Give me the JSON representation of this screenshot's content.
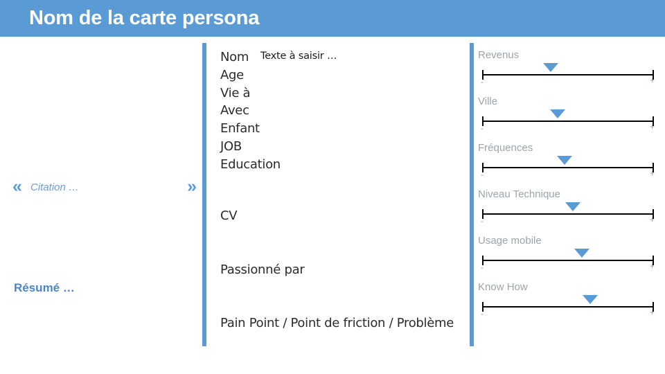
{
  "header": {
    "title": "Nom de la carte persona",
    "background_color": "#5b9bd5",
    "text_color": "#ffffff"
  },
  "left_column": {
    "quote": {
      "open_mark": "«",
      "text": "Citation …",
      "close_mark": "»",
      "color": "#6a9ed2"
    },
    "resume_label": "Résumé …",
    "resume_color": "#4a86c8"
  },
  "middle_column": {
    "placeholder": "Texte à saisir …",
    "fields": [
      {
        "label": "Nom"
      },
      {
        "label": "Age"
      },
      {
        "label": "Vie à"
      },
      {
        "label": "Avec"
      },
      {
        "label": "Enfant"
      },
      {
        "label": "JOB"
      },
      {
        "label": "Education"
      }
    ],
    "headings": {
      "cv": "CV",
      "passion": "Passionné par",
      "pain_point": "Pain Point / Point de friction / Problème"
    }
  },
  "right_column": {
    "minus_symbol": "-",
    "plus_symbol": "+",
    "marker_color": "#5b9bd5",
    "label_color": "#9aa5ad",
    "sliders": [
      {
        "label": "Revenus",
        "value_percent": 40
      },
      {
        "label": "Ville",
        "value_percent": 44
      },
      {
        "label": "Fréquences",
        "value_percent": 48
      },
      {
        "label": "Niveau Technique",
        "value_percent": 53
      },
      {
        "label": "Usage mobile",
        "value_percent": 58
      },
      {
        "label": "Know How",
        "value_percent": 63
      }
    ]
  },
  "dividers": {
    "color": "#5b9bd5"
  }
}
